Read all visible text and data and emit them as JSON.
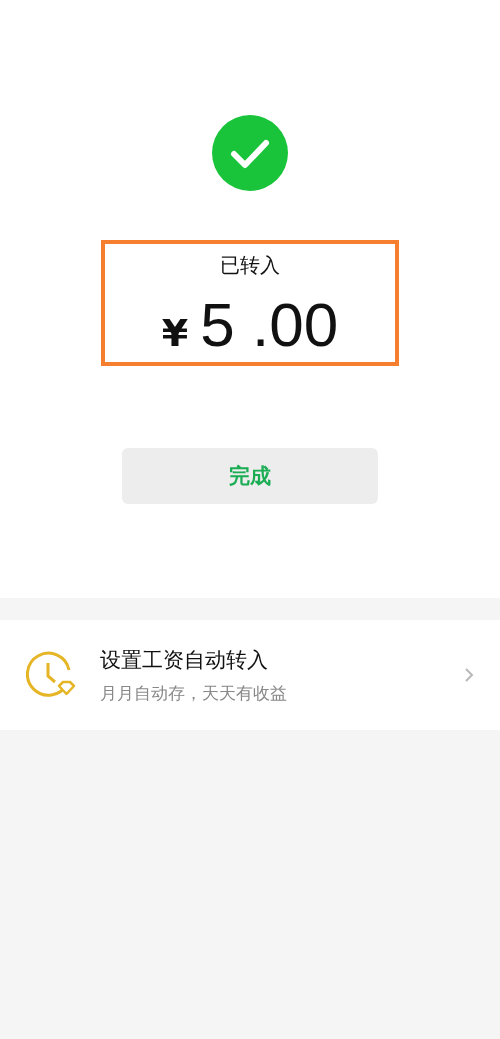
{
  "result": {
    "status": "已转入",
    "currency": "¥",
    "amount": "5 .00",
    "done_button": "完成"
  },
  "promo": {
    "title": "设置工资自动转入",
    "subtitle": "月月自动存，天天有收益"
  }
}
